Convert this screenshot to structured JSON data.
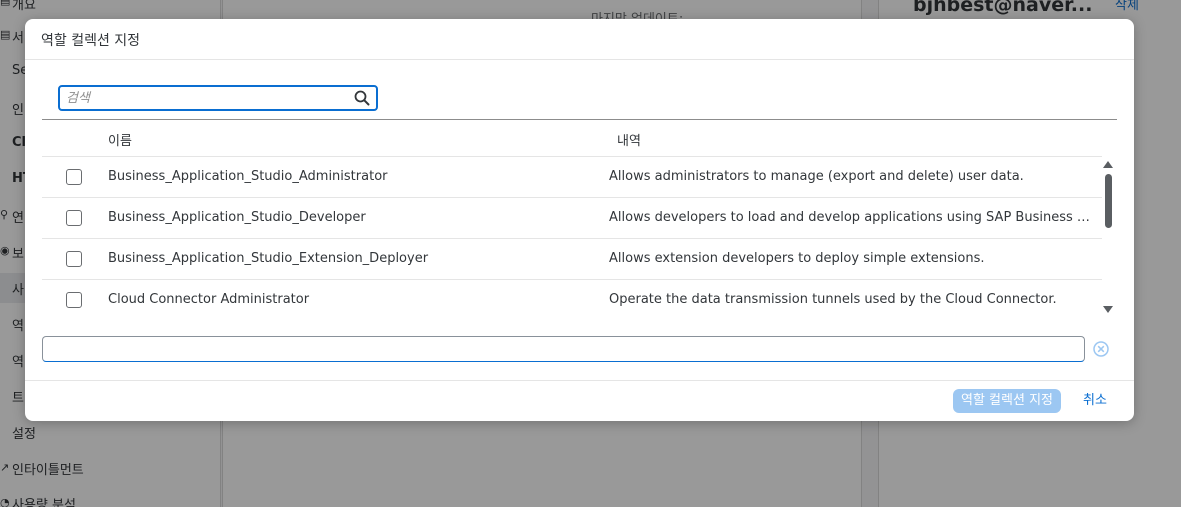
{
  "background": {
    "sidebar": {
      "items": [
        {
          "label": "개요",
          "icon": "overview-icon",
          "bold": false
        },
        {
          "label": "서",
          "icon": "services-icon",
          "bold": false
        },
        {
          "label": "Se",
          "icon": "",
          "bold": false
        },
        {
          "label": "인",
          "icon": "",
          "bold": false
        },
        {
          "label": "Cl",
          "icon": "",
          "bold": true
        },
        {
          "label": "HT",
          "icon": "",
          "bold": true
        },
        {
          "label": "연",
          "icon": "connectivity-icon",
          "bold": false
        },
        {
          "label": "보",
          "icon": "security-icon",
          "bold": false
        },
        {
          "label": "사",
          "icon": "",
          "bold": false
        },
        {
          "label": "역",
          "icon": "",
          "bold": false
        },
        {
          "label": "역",
          "icon": "",
          "bold": false
        },
        {
          "label": "트",
          "icon": "",
          "bold": false
        },
        {
          "label": "설정",
          "icon": "",
          "bold": false
        },
        {
          "label": "인타이틀먼트",
          "icon": "entitlements-icon",
          "bold": false
        },
        {
          "label": "사용량 분석",
          "icon": "usage-analytics-icon",
          "bold": false
        }
      ]
    },
    "main": {
      "last_update_label": "마지막 업데이트:"
    },
    "right_panel": {
      "user": "bjhbest@naver...",
      "delete_label": "삭제"
    }
  },
  "dialog": {
    "title": "역할 컬렉션 지정",
    "search": {
      "placeholder": "검색",
      "value": ""
    },
    "columns": {
      "name": "이름",
      "description": "내역"
    },
    "rows": [
      {
        "name": "Business_Application_Studio_Administrator",
        "description": "Allows administrators to manage (export and delete) user data.",
        "checked": false
      },
      {
        "name": "Business_Application_Studio_Developer",
        "description": "Allows developers to load and develop applications using SAP Business Application Studio.",
        "checked": false
      },
      {
        "name": "Business_Application_Studio_Extension_Deployer",
        "description": "Allows extension developers to deploy simple extensions.",
        "checked": false
      },
      {
        "name": "Cloud Connector Administrator",
        "description": "Operate the data transmission tunnels used by the Cloud Connector.",
        "checked": false
      }
    ],
    "footer": {
      "assign_label": "역할 컬렉션 지정",
      "cancel_label": "취소"
    },
    "colors": {
      "accent": "#0a6ed1",
      "disabled_button": "#9cc7f2"
    }
  }
}
